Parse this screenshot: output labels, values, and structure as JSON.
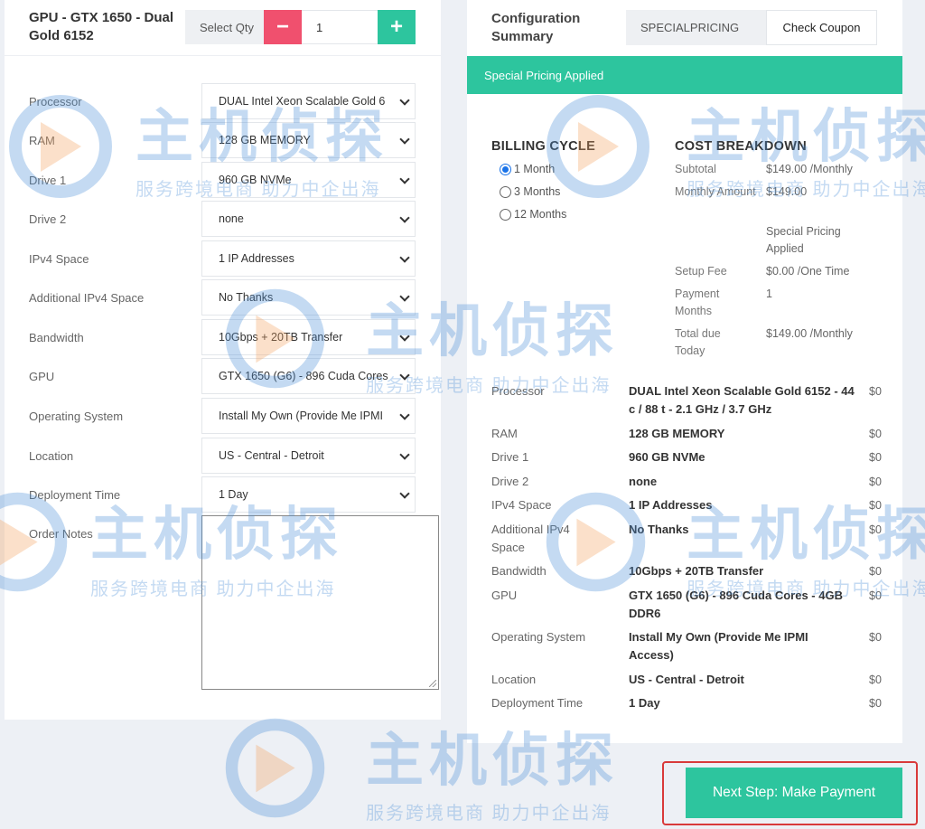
{
  "product": {
    "title": "GPU - GTX 1650 - Dual Gold 6152",
    "qty_label": "Select Qty",
    "qty_minus": "−",
    "qty_plus": "+",
    "qty_value": "1"
  },
  "config": [
    {
      "label": "Processor",
      "value": "DUAL Intel Xeon Scalable Gold 6"
    },
    {
      "label": "RAM",
      "value": "128 GB MEMORY"
    },
    {
      "label": "Drive 1",
      "value": "960 GB NVMe"
    },
    {
      "label": "Drive 2",
      "value": "none"
    },
    {
      "label": "IPv4 Space",
      "value": "1 IP Addresses"
    },
    {
      "label": "Additional IPv4 Space",
      "value": "No Thanks"
    },
    {
      "label": "Bandwidth",
      "value": "10Gbps + 20TB Transfer"
    },
    {
      "label": "GPU",
      "value": "GTX 1650 (G6) - 896 Cuda Cores -"
    },
    {
      "label": "Operating System",
      "value": "Install My Own (Provide Me IPMI"
    },
    {
      "label": "Location",
      "value": "US - Central - Detroit"
    },
    {
      "label": "Deployment Time",
      "value": "1 Day"
    }
  ],
  "order_notes_label": "Order Notes",
  "summary": {
    "title": "Configuration Summary",
    "coupon_value": "SPECIALPRICING",
    "coupon_button": "Check Coupon",
    "banner": "Special Pricing Applied",
    "billing_heading": "BILLING CYCLE",
    "billing_options": [
      {
        "label": "1 Month",
        "checked": true
      },
      {
        "label": "3 Months",
        "checked": false
      },
      {
        "label": "12 Months",
        "checked": false
      }
    ],
    "cost_heading": "COST BREAKDOWN",
    "costs": {
      "subtotal_label": "Subtotal",
      "subtotal_value": "$149.00 /Monthly",
      "monthly_label": "Monthly Amount",
      "monthly_value": "$149.00",
      "special_note": "Special Pricing Applied",
      "setup_label": "Setup Fee",
      "setup_value": "$0.00 /One Time",
      "payment_label": "Payment Months",
      "payment_value": "1",
      "total_label": "Total due Today",
      "total_value": "$149.00 /Monthly"
    },
    "items": [
      {
        "label": "Processor",
        "value": "DUAL Intel Xeon Scalable Gold 6152 - 44 c / 88 t - 2.1 GHz / 3.7 GHz",
        "price": "$0"
      },
      {
        "label": "RAM",
        "value": "128 GB MEMORY",
        "price": "$0"
      },
      {
        "label": "Drive 1",
        "value": "960 GB NVMe",
        "price": "$0"
      },
      {
        "label": "Drive 2",
        "value": "none",
        "price": "$0"
      },
      {
        "label": "IPv4 Space",
        "value": "1 IP Addresses",
        "price": "$0"
      },
      {
        "label": "Additional IPv4 Space",
        "value": "No Thanks",
        "price": "$0"
      },
      {
        "label": "Bandwidth",
        "value": "10Gbps + 20TB Transfer",
        "price": "$0"
      },
      {
        "label": "GPU",
        "value": "GTX 1650 (G6) - 896 Cuda Cores - 4GB DDR6",
        "price": "$0"
      },
      {
        "label": "Operating System",
        "value": "Install My Own (Provide Me IPMI Access)",
        "price": "$0"
      },
      {
        "label": "Location",
        "value": "US - Central - Detroit",
        "price": "$0"
      },
      {
        "label": "Deployment Time",
        "value": "1 Day",
        "price": "$0"
      }
    ]
  },
  "next_button": "Next Step: Make Payment",
  "watermark": {
    "big": "主机侦探",
    "small": "服务跨境电商 助力中企出海"
  },
  "colors": {
    "accent_green": "#2dc59e",
    "minus_red": "#f0506e",
    "highlight_border": "#d93a3a",
    "watermark_blue": "#4a8fd8"
  }
}
